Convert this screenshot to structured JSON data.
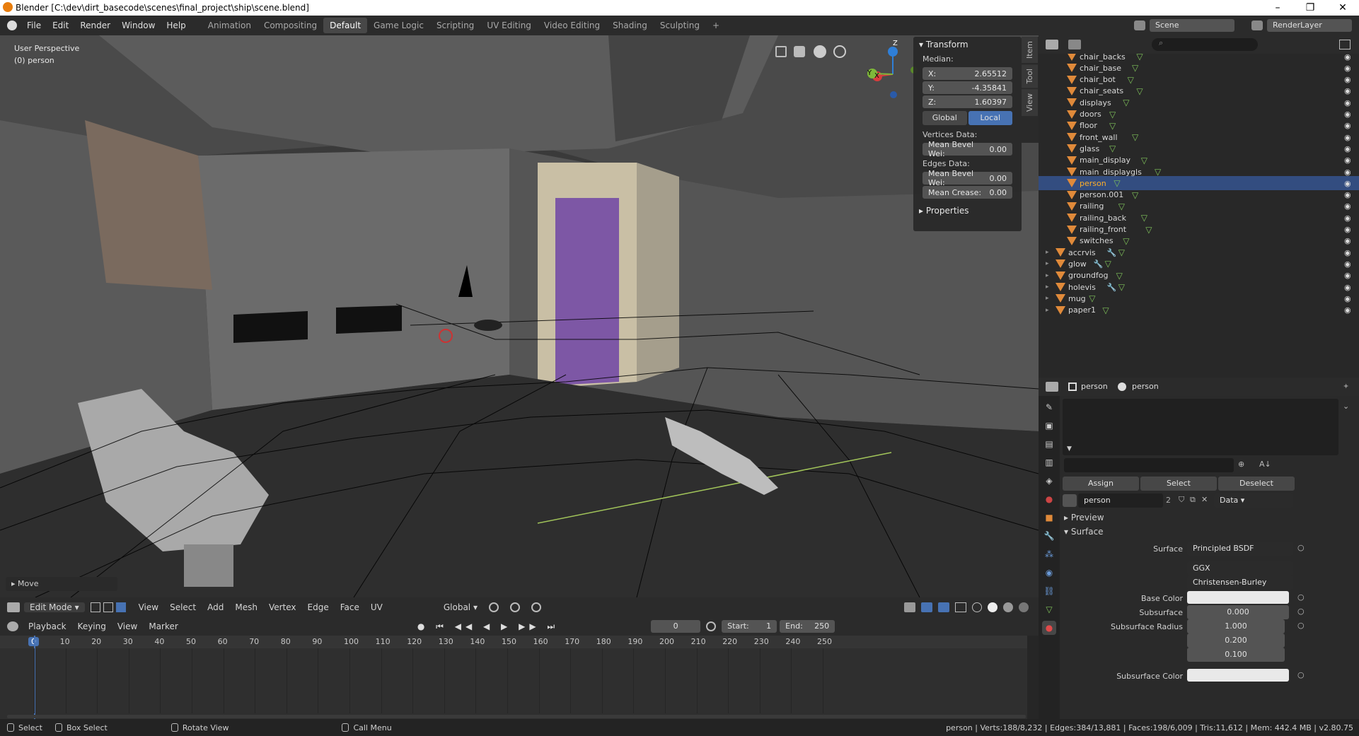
{
  "titlebar": {
    "title": "Blender [C:\\dev\\dirt_basecode\\scenes\\final_project\\ship\\scene.blend]",
    "minimize": "–",
    "maximize": "❐",
    "close": "✕"
  },
  "menu": {
    "items": [
      "File",
      "Edit",
      "Render",
      "Window",
      "Help"
    ]
  },
  "workspaces": [
    "Animation",
    "Compositing",
    "Default",
    "Game Logic",
    "Scripting",
    "UV Editing",
    "Video Editing",
    "Shading",
    "Sculpting"
  ],
  "scene": {
    "name": "Scene",
    "render_layer": "RenderLayer"
  },
  "viewport": {
    "perspective": "User Perspective",
    "object": "(0) person",
    "last_op": "Move",
    "gizmo": {
      "x": "X",
      "y": "Y",
      "z": "Z"
    }
  },
  "npanel": {
    "transform_title": "Transform",
    "median": "Median:",
    "x_label": "X:",
    "x_value": "2.65512",
    "y_label": "Y:",
    "y_value": "-4.35841",
    "z_label": "Z:",
    "z_value": "1.60397",
    "global": "Global",
    "local": "Local",
    "vertices_data": "Vertices Data:",
    "mean_bevel_v": "Mean Bevel Wei:",
    "mean_bevel_v_val": "0.00",
    "edges_data": "Edges Data:",
    "mean_bevel_e": "Mean Bevel Wei:",
    "mean_bevel_e_val": "0.00",
    "mean_crease": "Mean Crease:",
    "mean_crease_val": "0.00",
    "properties": "Properties",
    "tabs": [
      "Item",
      "Tool",
      "View"
    ]
  },
  "vp_header": {
    "mode": "Edit Mode",
    "menus": [
      "View",
      "Select",
      "Add",
      "Mesh",
      "Vertex",
      "Edge",
      "Face",
      "UV"
    ],
    "orientation": "Global"
  },
  "timeline": {
    "menus": [
      "Playback",
      "Keying",
      "View",
      "Marker"
    ],
    "current": "0",
    "start_label": "Start:",
    "start": "1",
    "end_label": "End:",
    "end": "250",
    "ticks": [
      "0",
      "10",
      "20",
      "30",
      "40",
      "50",
      "60",
      "70",
      "80",
      "90",
      "100",
      "110",
      "120",
      "130",
      "140",
      "150",
      "160",
      "170",
      "180",
      "190",
      "200",
      "210",
      "220",
      "230",
      "240",
      "250"
    ]
  },
  "status": {
    "select": "Select",
    "box_select": "Box Select",
    "rotate": "Rotate View",
    "call_menu": "Call Menu",
    "info": "person | Verts:188/8,232 | Edges:384/13,881 | Faces:198/6,009 | Tris:11,612 | Mem: 442.4 MB | v2.80.75"
  },
  "outliner": {
    "rows": [
      {
        "name": "chair_backs",
        "indent": 2,
        "wrench": false
      },
      {
        "name": "chair_base",
        "indent": 2,
        "wrench": false
      },
      {
        "name": "chair_bot",
        "indent": 2,
        "wrench": false
      },
      {
        "name": "chair_seats",
        "indent": 2,
        "wrench": false
      },
      {
        "name": "displays",
        "indent": 2,
        "wrench": false
      },
      {
        "name": "doors",
        "indent": 2,
        "wrench": false
      },
      {
        "name": "floor",
        "indent": 2,
        "wrench": false
      },
      {
        "name": "front_wall",
        "indent": 2,
        "wrench": false
      },
      {
        "name": "glass",
        "indent": 2,
        "wrench": false
      },
      {
        "name": "main_display",
        "indent": 2,
        "wrench": false
      },
      {
        "name": "main_displaygls",
        "indent": 2,
        "wrench": false
      },
      {
        "name": "person",
        "indent": 2,
        "wrench": false,
        "selected": true
      },
      {
        "name": "person.001",
        "indent": 2,
        "wrench": false
      },
      {
        "name": "railing",
        "indent": 2,
        "wrench": false
      },
      {
        "name": "railing_back",
        "indent": 2,
        "wrench": false
      },
      {
        "name": "railing_front",
        "indent": 2,
        "wrench": false
      },
      {
        "name": "switches",
        "indent": 2,
        "wrench": false
      },
      {
        "name": "accrvis",
        "indent": 1,
        "wrench": true
      },
      {
        "name": "glow",
        "indent": 1,
        "wrench": true
      },
      {
        "name": "groundfog",
        "indent": 1,
        "wrench": false
      },
      {
        "name": "holevis",
        "indent": 1,
        "wrench": true
      },
      {
        "name": "mug",
        "indent": 1,
        "wrench": false
      },
      {
        "name": "paper1",
        "indent": 1,
        "wrench": false
      }
    ]
  },
  "properties": {
    "object": "person",
    "material": "person",
    "assign": "Assign",
    "select": "Select",
    "deselect": "Deselect",
    "mat_name": "person",
    "users": "2",
    "link": "Data",
    "preview": "Preview",
    "surface_section": "Surface",
    "surface_label": "Surface",
    "surface_value": "Principled BSDF",
    "distribution": "GGX",
    "subsurface_method": "Christensen-Burley",
    "base_color_label": "Base Color",
    "subsurface_label": "Subsurface",
    "subsurface_value": "0.000",
    "subsurface_radius_label": "Subsurface Radius",
    "radius": [
      "1.000",
      "0.200",
      "0.100"
    ],
    "subsurface_color_label": "Subsurface Color"
  }
}
